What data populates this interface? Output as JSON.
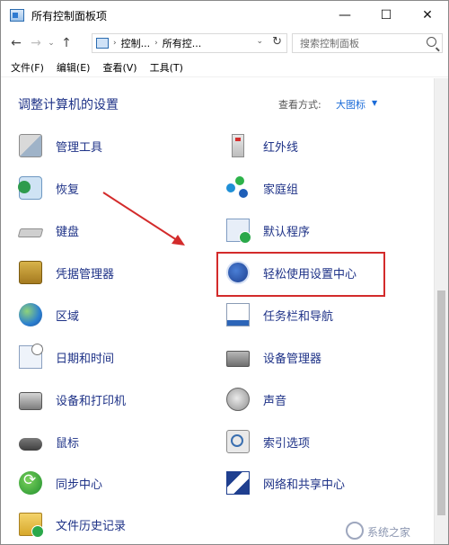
{
  "window": {
    "title": "所有控制面板项",
    "minimize_glyph": "—",
    "maximize_glyph": "☐",
    "close_glyph": "✕"
  },
  "nav": {
    "back_glyph": "←",
    "forward_glyph": "→",
    "recent_glyph": "⌄",
    "up_glyph": "↑",
    "breadcrumb": [
      "控制...",
      "所有控..."
    ],
    "refresh_glyph": "↻",
    "search_placeholder": "搜索控制面板"
  },
  "menubar": [
    "文件(F)",
    "编辑(E)",
    "查看(V)",
    "工具(T)"
  ],
  "content": {
    "heading": "调整计算机的设置",
    "view_by_label": "查看方式:",
    "view_by_value": "大图标",
    "view_by_caret": "▼"
  },
  "items_left": [
    {
      "label": "管理工具",
      "icon": "admin-tools-icon"
    },
    {
      "label": "恢复",
      "icon": "recovery-icon"
    },
    {
      "label": "键盘",
      "icon": "keyboard-icon"
    },
    {
      "label": "凭据管理器",
      "icon": "credential-manager-icon"
    },
    {
      "label": "区域",
      "icon": "region-globe-icon"
    },
    {
      "label": "日期和时间",
      "icon": "date-time-icon"
    },
    {
      "label": "设备和打印机",
      "icon": "printer-icon"
    },
    {
      "label": "鼠标",
      "icon": "mouse-icon"
    },
    {
      "label": "同步中心",
      "icon": "sync-icon"
    },
    {
      "label": "文件历史记录",
      "icon": "file-history-icon"
    }
  ],
  "items_right": [
    {
      "label": "红外线",
      "icon": "infrared-icon"
    },
    {
      "label": "家庭组",
      "icon": "homegroup-icon"
    },
    {
      "label": "默认程序",
      "icon": "default-programs-icon"
    },
    {
      "label": "轻松使用设置中心",
      "icon": "ease-of-access-icon"
    },
    {
      "label": "任务栏和导航",
      "icon": "taskbar-icon"
    },
    {
      "label": "设备管理器",
      "icon": "device-manager-icon"
    },
    {
      "label": "声音",
      "icon": "sound-icon"
    },
    {
      "label": "索引选项",
      "icon": "indexing-icon"
    },
    {
      "label": "网络和共享中心",
      "icon": "network-icon"
    }
  ],
  "annotation": {
    "highlight_color": "#d32b2b",
    "arrow_color": "#d32b2b"
  },
  "watermark": {
    "text": "系统之家"
  }
}
